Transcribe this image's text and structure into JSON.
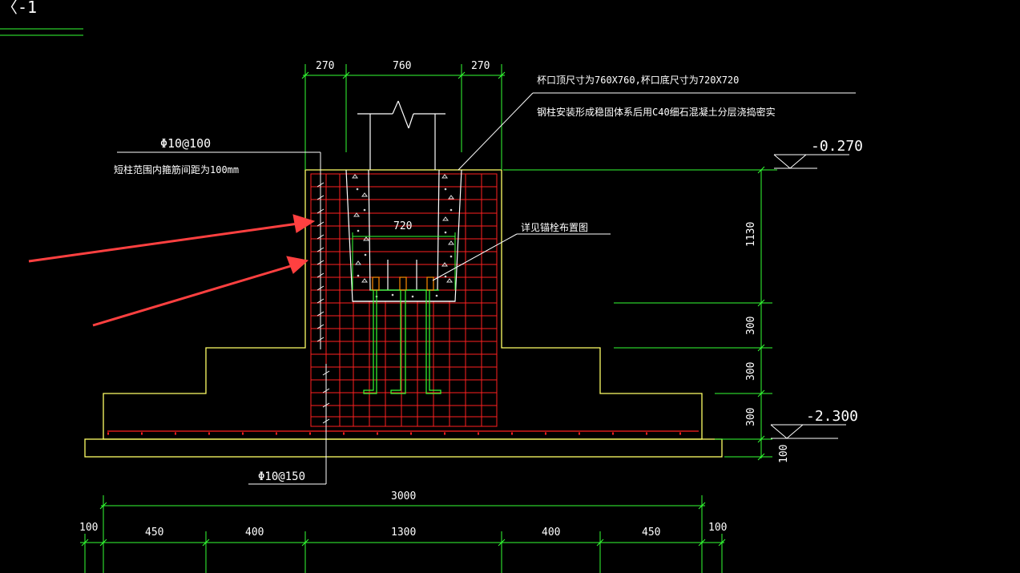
{
  "colors": {
    "background": "#000000",
    "outline": "#ffff66",
    "rebar": "#ff2020",
    "dimension": "#33ff33",
    "text": "#ffffff",
    "concrete": "#ffffff",
    "arrow": "#ff4040"
  },
  "title_fragment": "〈-1",
  "dimensions": {
    "top_left_270": "270",
    "top_mid_760": "760",
    "top_right_270": "270",
    "cup_width_720": "720",
    "right_1130": "1130",
    "right_300_a": "300",
    "right_300_b": "300",
    "right_300_c": "300",
    "right_100": "100",
    "bottom_total_3000": "3000",
    "bottom_100_left": "100",
    "bottom_450_left": "450",
    "bottom_400_left": "400",
    "bottom_1300": "1300",
    "bottom_400_right": "400",
    "bottom_450_right": "450",
    "bottom_100_right": "100"
  },
  "levels": {
    "top": "-0.270",
    "bottom": "-2.300"
  },
  "annotations": {
    "cup_size": "杯口顶尺寸为760X760,杯口底尺寸为720X720",
    "grout": "钢柱安装形成稳固体系后用C40细石混凝土分层浇捣密实",
    "stirrup_label": "Φ10@100",
    "stirrup_note": "短柱范围内箍筋间距为100mm",
    "bolt_note": "详见锚栓布置图",
    "bottom_bar": "Φ10@150"
  }
}
